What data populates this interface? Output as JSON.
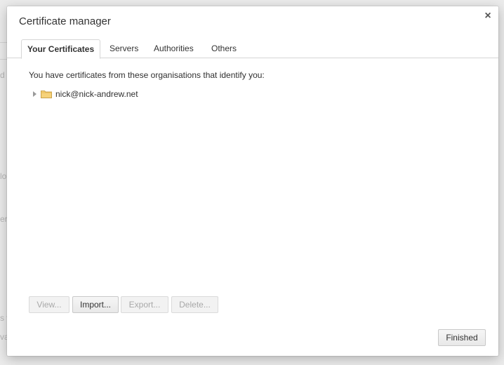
{
  "background": {
    "fragments": [
      "d",
      "lo",
      "ers",
      "s v",
      "va"
    ]
  },
  "dialog": {
    "title": "Certificate manager",
    "close_icon": "close-icon",
    "tabs": [
      {
        "label": "Your Certificates",
        "active": true
      },
      {
        "label": "Servers",
        "active": false
      },
      {
        "label": "Authorities",
        "active": false
      },
      {
        "label": "Others",
        "active": false
      }
    ],
    "description": "You have certificates from these organisations that identify you:",
    "tree": [
      {
        "label": "nick@nick-andrew.net",
        "expanded": false,
        "icon": "folder-icon"
      }
    ],
    "actions": [
      {
        "label": "View...",
        "enabled": false
      },
      {
        "label": "Import...",
        "enabled": true
      },
      {
        "label": "Export...",
        "enabled": false
      },
      {
        "label": "Delete...",
        "enabled": false
      }
    ],
    "finished_label": "Finished"
  }
}
